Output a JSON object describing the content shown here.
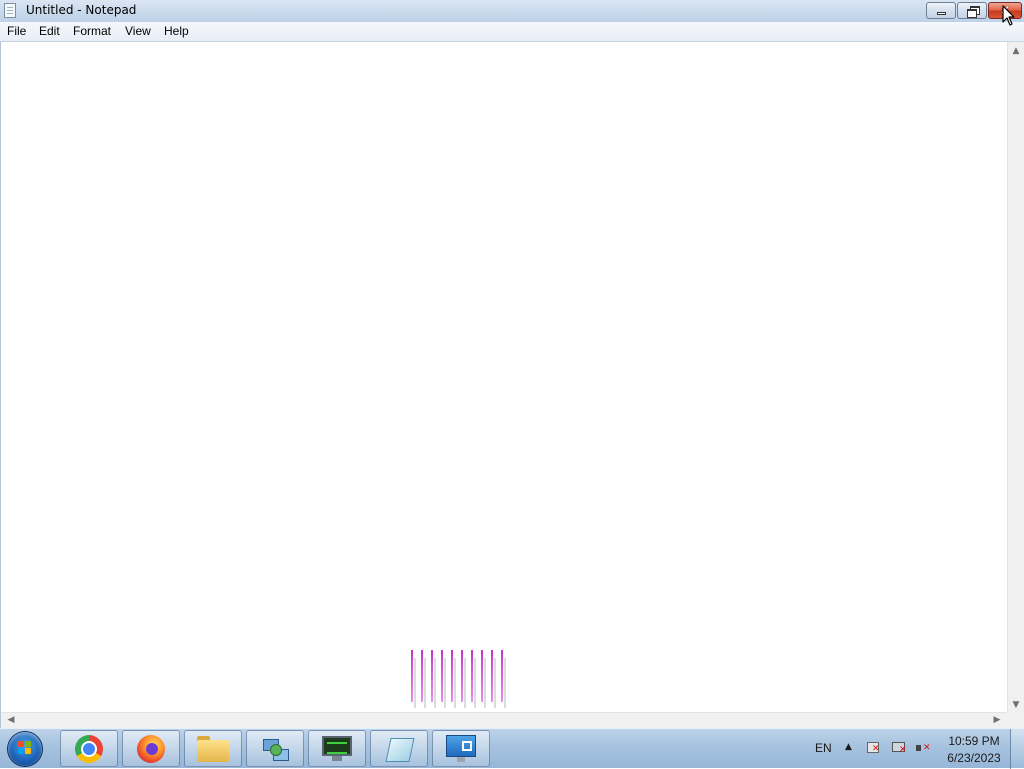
{
  "window": {
    "title": "Untitled - Notepad",
    "controls": {
      "minimize": "minimize",
      "maximize": "restore",
      "close": "close"
    }
  },
  "menu": {
    "items": [
      "File",
      "Edit",
      "Format",
      "View",
      "Help"
    ]
  },
  "editor": {
    "content": ""
  },
  "taskbar": {
    "pinned": [
      {
        "name": "chrome-icon"
      },
      {
        "name": "firefox-icon"
      },
      {
        "name": "file-explorer-icon"
      },
      {
        "name": "network-icon"
      },
      {
        "name": "system-monitor-icon"
      },
      {
        "name": "notepad-icon"
      },
      {
        "name": "control-panel-icon"
      }
    ],
    "tray": {
      "language": "EN",
      "time": "10:59 PM",
      "date": "6/23/2023"
    }
  },
  "colors": {
    "close_button": "#d9573a",
    "taskbar": "#a6c2df",
    "titlebar": "#c9d9ec"
  }
}
